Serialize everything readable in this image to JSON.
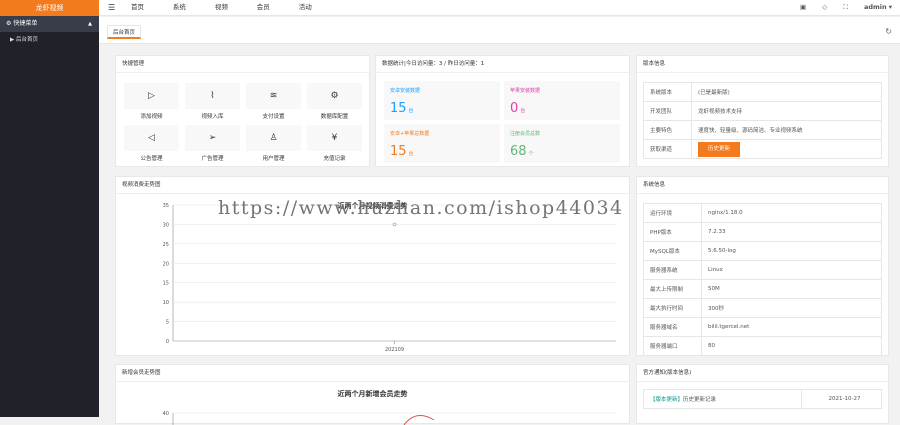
{
  "app": {
    "logo": "龙虾视频"
  },
  "sidebar": {
    "group": "快捷菜单",
    "items": [
      {
        "label": "后台首页"
      }
    ]
  },
  "topnav": {
    "items": [
      "首页",
      "系统",
      "视频",
      "会员",
      "活动"
    ],
    "user": "admin"
  },
  "tabs": [
    {
      "label": "后台首页"
    }
  ],
  "quick": {
    "title": "快捷管理",
    "items": [
      {
        "label": "添加视频",
        "icon": "play-icon"
      },
      {
        "label": "视频入库",
        "icon": "pulse-icon"
      },
      {
        "label": "支付设置",
        "icon": "layers-icon"
      },
      {
        "label": "数据库配置",
        "icon": "gear-icon"
      },
      {
        "label": "公告管理",
        "icon": "speaker-icon"
      },
      {
        "label": "广告管理",
        "icon": "send-icon"
      },
      {
        "label": "用户管理",
        "icon": "user-icon"
      },
      {
        "label": "充值记录",
        "icon": "yen-icon"
      }
    ]
  },
  "stats": {
    "title": "数据统计|今日访问量：3 / 昨日访问量：1",
    "items": [
      {
        "title": "安卓安装数据",
        "value": "15",
        "unit": "台",
        "color": "#1e9fff"
      },
      {
        "title": "苹果安装数据",
        "value": "0",
        "unit": "台",
        "color": "#e23ea8"
      },
      {
        "title": "安卓+苹果总数据",
        "value": "15",
        "unit": "台",
        "color": "#f37b1d"
      },
      {
        "title": "注册会员总数",
        "value": "68",
        "unit": "个",
        "color": "#5fb878"
      }
    ]
  },
  "version": {
    "title": "版本信息",
    "rows": [
      {
        "k": "系统版本",
        "v": "(已是最新版)"
      },
      {
        "k": "开发团队",
        "v": "龙虾视频技术支持"
      },
      {
        "k": "主要特色",
        "v": "速度快、轻量级、源码简洁、专业视频系统"
      }
    ],
    "get_label": "获取渠道",
    "history_btn": "历史更新"
  },
  "chart1": {
    "panel_title": "视频消费走势图"
  },
  "chart2": {
    "panel_title": "新增会员走势图"
  },
  "sysinfo": {
    "title": "系统信息",
    "rows": [
      {
        "k": "运行环境",
        "v": "nginx/1.18.0"
      },
      {
        "k": "PHP版本",
        "v": "7.2.33"
      },
      {
        "k": "MySQL版本",
        "v": "5.6.50-log"
      },
      {
        "k": "服务器系统",
        "v": "Linux"
      },
      {
        "k": "最大上传限制",
        "v": "50M"
      },
      {
        "k": "最大执行时间",
        "v": "300秒"
      },
      {
        "k": "服务器域名",
        "v": "bilil.tgercel.net"
      },
      {
        "k": "服务器端口",
        "v": "80"
      }
    ]
  },
  "notice": {
    "title": "官方通知(版本信息)",
    "tag": "【版本更新】",
    "text": "历史更新记录",
    "date": "2021-10-27"
  },
  "watermark": "https://www.huzhan.com/ishop44034",
  "chart_data": [
    {
      "type": "line",
      "title": "近两个月视频消费走势",
      "categories": [
        "202109"
      ],
      "series": [
        {
          "values": [
            30
          ]
        }
      ],
      "ylim": [
        0,
        35
      ],
      "yticks": [
        0,
        5,
        10,
        15,
        20,
        25,
        30,
        35
      ]
    },
    {
      "type": "line",
      "title": "近两个月新增会员走势",
      "ylim": [
        0,
        40
      ],
      "yticks": [
        40
      ],
      "series": []
    }
  ]
}
